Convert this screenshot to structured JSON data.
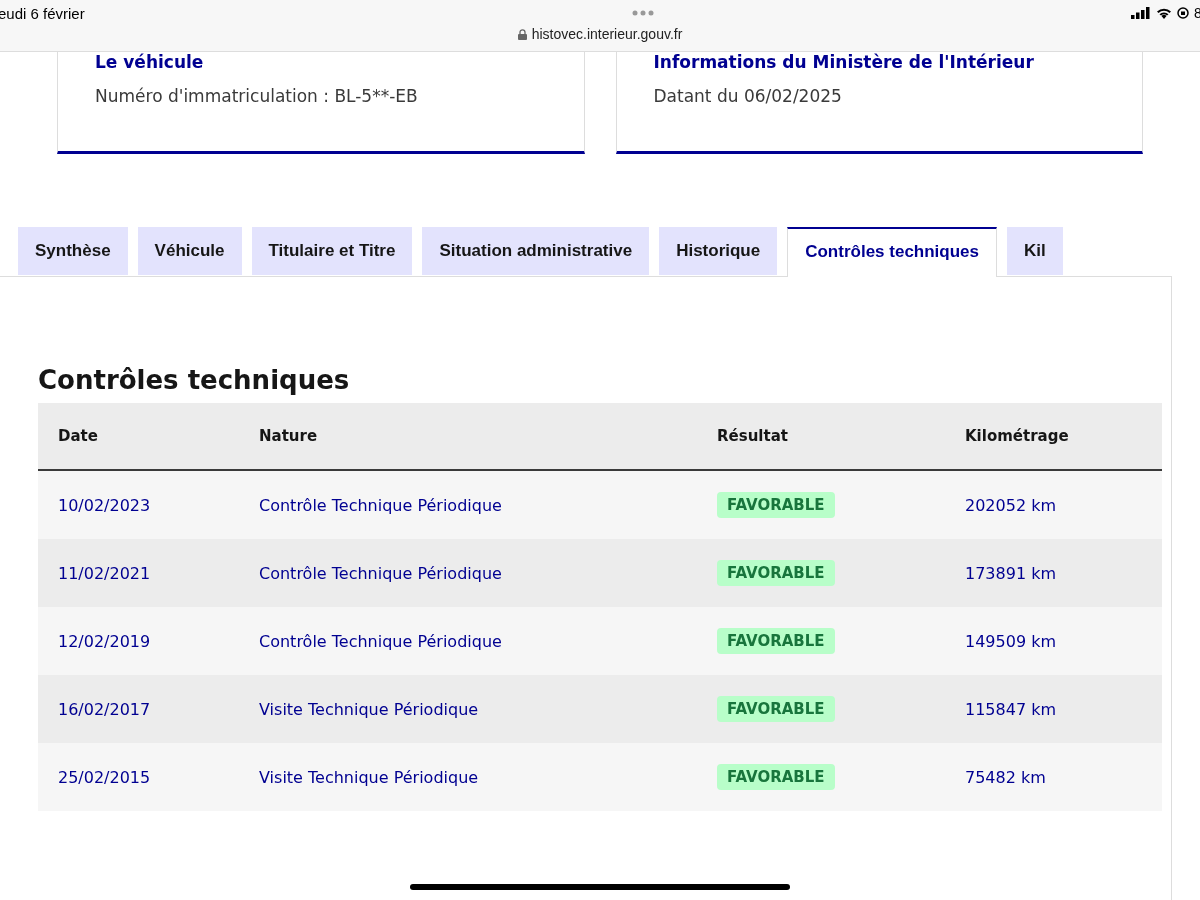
{
  "status_bar": {
    "date": "eudi 6 février",
    "battery": "8"
  },
  "address_bar": {
    "url": "histovec.interieur.gouv.fr"
  },
  "cards": [
    {
      "title": "Le véhicule",
      "text": "Numéro d'immatriculation : BL-5**-EB"
    },
    {
      "title": "Informations du Ministère de l'Intérieur",
      "text": "Datant du 06/02/2025"
    }
  ],
  "tabs": [
    {
      "label": "Synthèse",
      "selected": false
    },
    {
      "label": "Véhicule",
      "selected": false
    },
    {
      "label": "Titulaire et Titre",
      "selected": false
    },
    {
      "label": "Situation administrative",
      "selected": false
    },
    {
      "label": "Historique",
      "selected": false
    },
    {
      "label": "Contrôles techniques",
      "selected": true
    },
    {
      "label": "Kil",
      "selected": false
    }
  ],
  "section_title": "Contrôles techniques",
  "table": {
    "columns": [
      "Date",
      "Nature",
      "Résultat",
      "Kilométrage"
    ],
    "rows": [
      {
        "date": "10/02/2023",
        "nature": "Contrôle Technique Périodique",
        "result": "FAVORABLE",
        "mileage": "202052 km"
      },
      {
        "date": "11/02/2021",
        "nature": "Contrôle Technique Périodique",
        "result": "FAVORABLE",
        "mileage": "173891 km"
      },
      {
        "date": "12/02/2019",
        "nature": "Contrôle Technique Périodique",
        "result": "FAVORABLE",
        "mileage": "149509 km"
      },
      {
        "date": "16/02/2017",
        "nature": "Visite Technique Périodique",
        "result": "FAVORABLE",
        "mileage": "115847 km"
      },
      {
        "date": "25/02/2015",
        "nature": "Visite Technique Périodique",
        "result": "FAVORABLE",
        "mileage": "75482 km"
      }
    ]
  }
}
